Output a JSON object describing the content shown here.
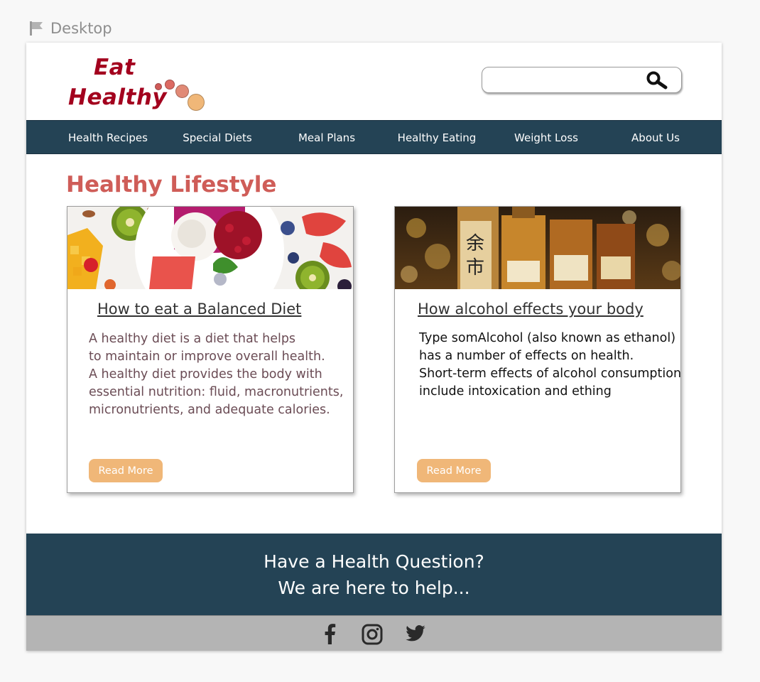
{
  "artboard": {
    "label": "Desktop"
  },
  "logo": {
    "line1": "Eat",
    "line2": "Healthy"
  },
  "search": {
    "value": "",
    "placeholder": ""
  },
  "nav": {
    "items": [
      {
        "label": "Health Recipes"
      },
      {
        "label": "Special Diets"
      },
      {
        "label": "Meal Plans"
      },
      {
        "label": "Healthy Eating"
      },
      {
        "label": "Weight Loss"
      },
      {
        "label": "About Us"
      }
    ]
  },
  "main": {
    "section_title": "Healthy Lifestyle",
    "cards": [
      {
        "title": "How to eat a Balanced Diet",
        "body": [
          "A healthy diet is a diet that helps",
          "to maintain or improve overall health.",
          "A healthy diet provides the body with",
          "essential nutrition: fluid, macronutrients,",
          "micronutrients, and adequate calories."
        ],
        "button": "Read More",
        "image": "fruit-bowl-photo"
      },
      {
        "title": "How alcohol effects your body",
        "body": [
          "Type somAlcohol (also known as ethanol)",
          "has a number of effects on health.",
          "Short-term effects of alcohol consumption",
          "include intoxication and ething"
        ],
        "button": "Read More",
        "image": "whisky-bottles-photo"
      }
    ]
  },
  "banner": {
    "line1": "Have a Health Question?",
    "line2": "We are here to help..."
  },
  "footer": {
    "icons": [
      "facebook-icon",
      "instagram-icon",
      "twitter-icon"
    ]
  },
  "colors": {
    "brand_red": "#a3001e",
    "accent_coral": "#cf5d58",
    "navy": "#244355",
    "button_peach": "#f0b778",
    "footer_gray": "#b4b4b4"
  }
}
